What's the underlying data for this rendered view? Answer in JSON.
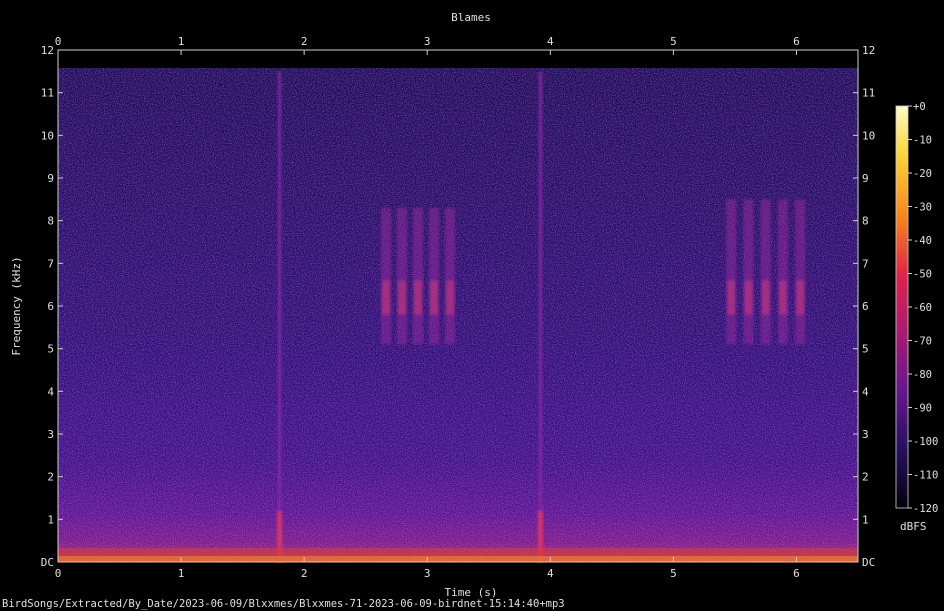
{
  "chart_data": {
    "type": "heatmap",
    "title": "Blames",
    "xlabel": "Time (s)",
    "ylabel": "Frequency (kHz)",
    "xlim": [
      0,
      6.5
    ],
    "ylim": [
      0,
      12
    ],
    "x_ticks": [
      "0",
      "1",
      "2",
      "3",
      "4",
      "5",
      "6"
    ],
    "y_ticks": [
      "DC",
      "1",
      "2",
      "3",
      "4",
      "5",
      "6",
      "7",
      "8",
      "9",
      "10",
      "11",
      "12"
    ],
    "colorbar": {
      "label": "dBFS",
      "range": [
        -120,
        0
      ],
      "ticks": [
        "+0",
        "-10",
        "-20",
        "-30",
        "-40",
        "-50",
        "-60",
        "-70",
        "-80",
        "-90",
        "-100",
        "-110",
        "-120"
      ]
    },
    "grid": false,
    "features": [
      {
        "kind": "broadband_click",
        "time_s": 1.8
      },
      {
        "kind": "broadband_click",
        "time_s": 3.92
      },
      {
        "kind": "call_cluster",
        "time_range_s": [
          2.6,
          3.25
        ],
        "freq_range_khz": [
          5.1,
          8.3
        ]
      },
      {
        "kind": "call_cluster",
        "time_range_s": [
          5.4,
          6.1
        ],
        "freq_range_khz": [
          5.1,
          8.5
        ]
      }
    ]
  },
  "footer": {
    "file_path": "BirdSongs/Extracted/By_Date/2023-06-09/Blxxmes/Blxxmes-71-2023-06-09-birdnet-15:14:40+mp3"
  }
}
